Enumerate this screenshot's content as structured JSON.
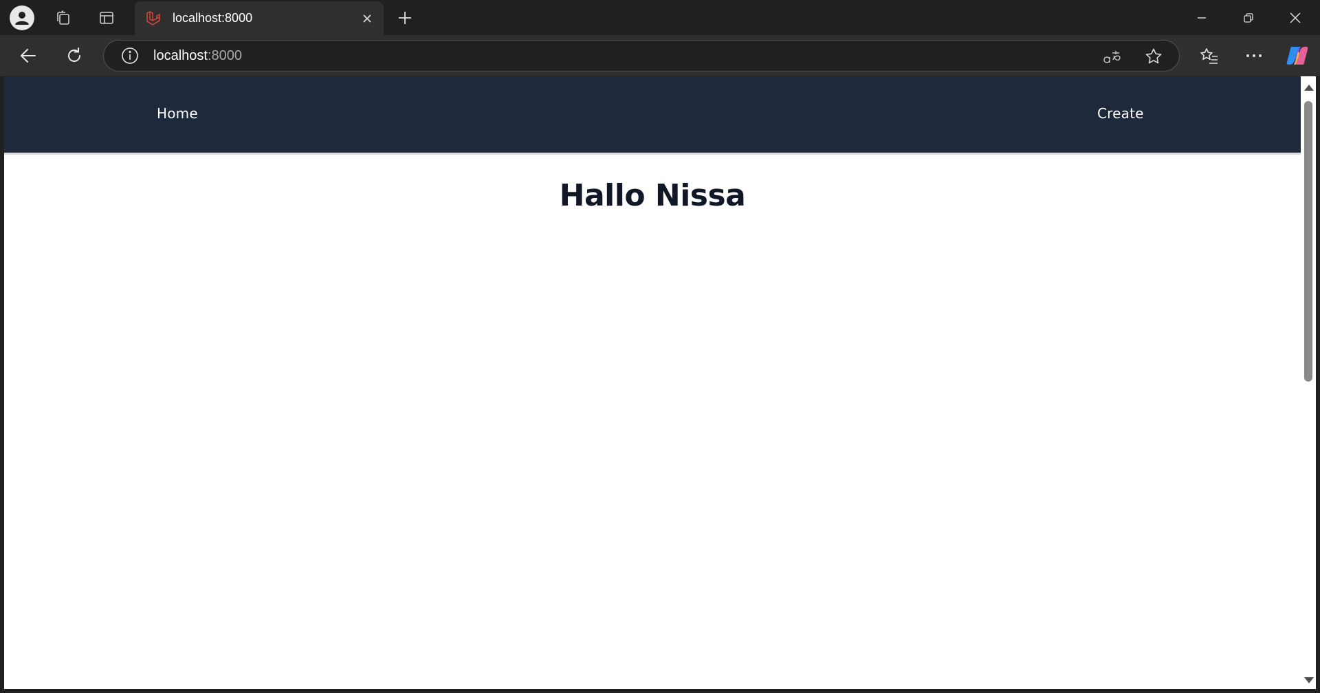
{
  "browser": {
    "tab": {
      "title": "localhost:8000"
    },
    "address_bar": {
      "host": "localhost",
      "port": ":8000"
    },
    "icons": {
      "profile": "profile-icon",
      "workspaces": "workspaces-icon",
      "tab_actions": "tab-actions-icon",
      "favicon": "laravel-icon",
      "tab_close": "close-icon",
      "new_tab": "plus-icon",
      "minimize": "minimize-icon",
      "restore": "restore-icon",
      "close": "close-icon",
      "back": "arrow-left-icon",
      "reload": "reload-icon",
      "site_info": "info-icon",
      "translate": "translate-icon",
      "add_favorite": "star-icon",
      "favorites": "favorites-icon",
      "more": "more-icon",
      "copilot": "copilot-icon"
    }
  },
  "page": {
    "nav": {
      "home_label": "Home",
      "create_label": "Create",
      "background": "#1e293b"
    },
    "heading": "Hallo Nissa"
  }
}
